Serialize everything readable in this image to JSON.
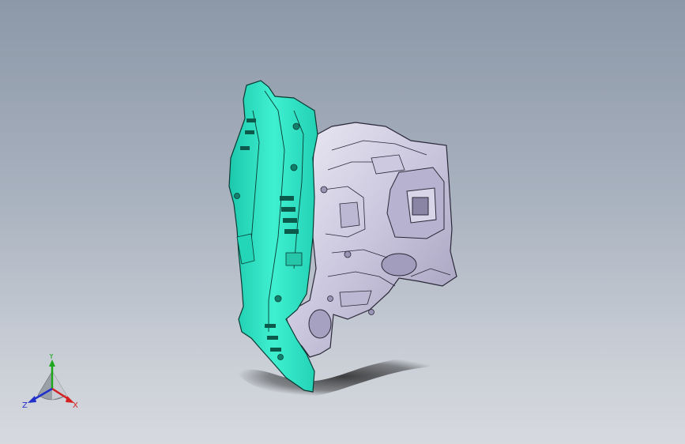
{
  "triad": {
    "x_label": "X",
    "y_label": "Y",
    "z_label": "Z",
    "colors": {
      "x": "#d42020",
      "y": "#1fa61f",
      "z": "#2030c8"
    }
  },
  "model": {
    "parts": [
      {
        "name": "cyan-bracket-part",
        "color": "#2fe0c2"
      },
      {
        "name": "gray-panel-part",
        "color": "#c8c4dc"
      }
    ]
  }
}
